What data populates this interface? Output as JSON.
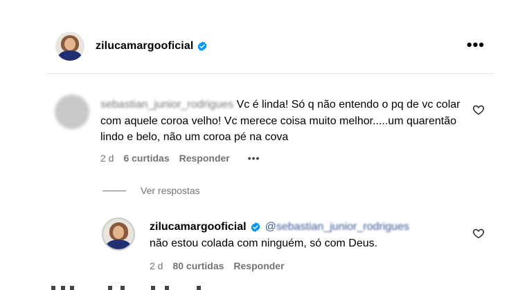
{
  "header": {
    "username": "zilucamargooficial",
    "more_icon": "more-horizontal-icon",
    "verified_color": "#0095f6"
  },
  "comment": {
    "username": "sebastian_junior_rodrigues",
    "text": "Vc é linda! Só q não entendo o pq de vc colar com aquele coroa velho! Vc merece coisa muito melhor.....um quarentão lindo e belo, não um coroa pé na cova",
    "time": "2 d",
    "likes": "6 curtidas",
    "reply_label": "Responder",
    "options": "•••"
  },
  "replies_toggle": "Ver respostas",
  "reply": {
    "username": "zilucamargooficial",
    "mention": "sebastian_junior_rodrigues",
    "at": "@",
    "text": "não estou colada com ninguém, só com Deus.",
    "time": "2 d",
    "likes": "80 curtidas",
    "reply_label": "Responder"
  },
  "colors": {
    "meta_text": "#737373",
    "mention": "#3d5a98",
    "avatar_body": "#1f2f72"
  }
}
